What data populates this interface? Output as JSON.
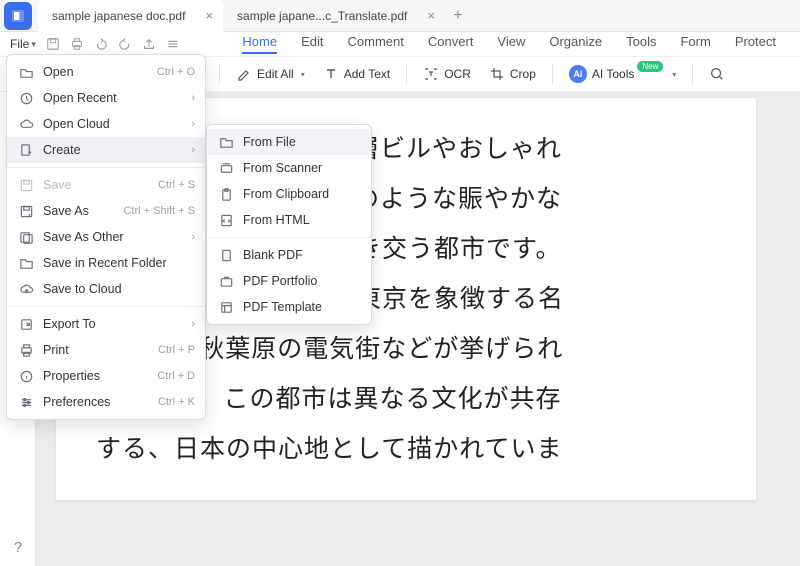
{
  "tabs": [
    {
      "title": "sample japanese doc.pdf",
      "active": true
    },
    {
      "title": "sample  japane...c_Translate.pdf",
      "active": false
    }
  ],
  "file_label": "File",
  "ribbon": {
    "tabs": [
      "Home",
      "Edit",
      "Comment",
      "Convert",
      "View",
      "Organize",
      "Tools",
      "Form",
      "Protect"
    ],
    "active": "Home"
  },
  "toolbar": {
    "edit_all": "Edit All",
    "add_text": "Add Text",
    "ocr": "OCR",
    "crop": "Crop",
    "ai_tools": "AI Tools",
    "new_badge": "New"
  },
  "file_menu": [
    {
      "id": "open",
      "label": "Open",
      "shortcut": "Ctrl + O",
      "icon": "open"
    },
    {
      "id": "open-recent",
      "label": "Open Recent",
      "submenu": true,
      "icon": "recent"
    },
    {
      "id": "open-cloud",
      "label": "Open Cloud",
      "submenu": true,
      "icon": "cloud"
    },
    {
      "id": "create",
      "label": "Create",
      "submenu": true,
      "icon": "create",
      "highlight": true
    },
    {
      "div": true
    },
    {
      "id": "save",
      "label": "Save",
      "shortcut": "Ctrl + S",
      "icon": "save",
      "disabled": true
    },
    {
      "id": "save-as",
      "label": "Save As",
      "shortcut": "Ctrl + Shift + S",
      "icon": "saveas"
    },
    {
      "id": "save-other",
      "label": "Save As Other",
      "submenu": true,
      "icon": "saveother"
    },
    {
      "id": "save-recent",
      "label": "Save in Recent Folder",
      "icon": "folder"
    },
    {
      "id": "save-cloud",
      "label": "Save to Cloud",
      "icon": "cloudup"
    },
    {
      "div": true
    },
    {
      "id": "export",
      "label": "Export To",
      "submenu": true,
      "icon": "export"
    },
    {
      "id": "print",
      "label": "Print",
      "shortcut": "Ctrl + P",
      "icon": "print"
    },
    {
      "id": "properties",
      "label": "Properties",
      "shortcut": "Ctrl + D",
      "icon": "info"
    },
    {
      "id": "preferences",
      "label": "Preferences",
      "shortcut": "Ctrl + K",
      "icon": "prefs"
    }
  ],
  "create_submenu": [
    {
      "id": "from-file",
      "label": "From File",
      "icon": "folder",
      "highlight": true
    },
    {
      "id": "from-scanner",
      "label": "From Scanner",
      "icon": "scanner"
    },
    {
      "id": "from-clipboard",
      "label": "From Clipboard",
      "icon": "clipboard"
    },
    {
      "id": "from-html",
      "label": "From HTML",
      "icon": "html"
    },
    {
      "div": true
    },
    {
      "id": "blank-pdf",
      "label": "Blank PDF",
      "icon": "blank"
    },
    {
      "id": "pdf-portfolio",
      "label": "PDF Portfolio",
      "icon": "portfolio"
    },
    {
      "id": "pdf-template",
      "label": "PDF Template",
      "icon": "template"
    }
  ],
  "doc_lines": [
    "ち、高層ビルやおしゃれ",
    "や渋谷のような賑やかな",
    "地区で忙しい人々が行き交う都市です。",
    "伝統と現代が融合する東京を象徴する名",
    "所として秋葉原の電気街などが挙げられ",
    "ています。この都市は異なる文化が共存",
    "する、日本の中心地として描かれていま"
  ]
}
